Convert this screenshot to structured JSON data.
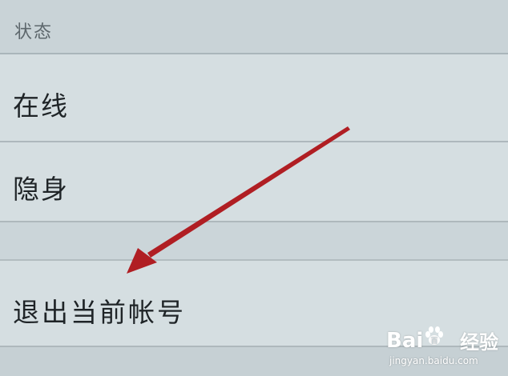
{
  "status_section": {
    "header": "状态"
  },
  "options": {
    "online": "在线",
    "hidden": "隐身",
    "logout": "退出当前帐号"
  },
  "annotation": {
    "arrow_color": "#b01e23"
  },
  "watermark": {
    "logo_left": "Bai",
    "logo_right": "百",
    "brand": "经验",
    "url": "jingyan.baidu.com"
  }
}
